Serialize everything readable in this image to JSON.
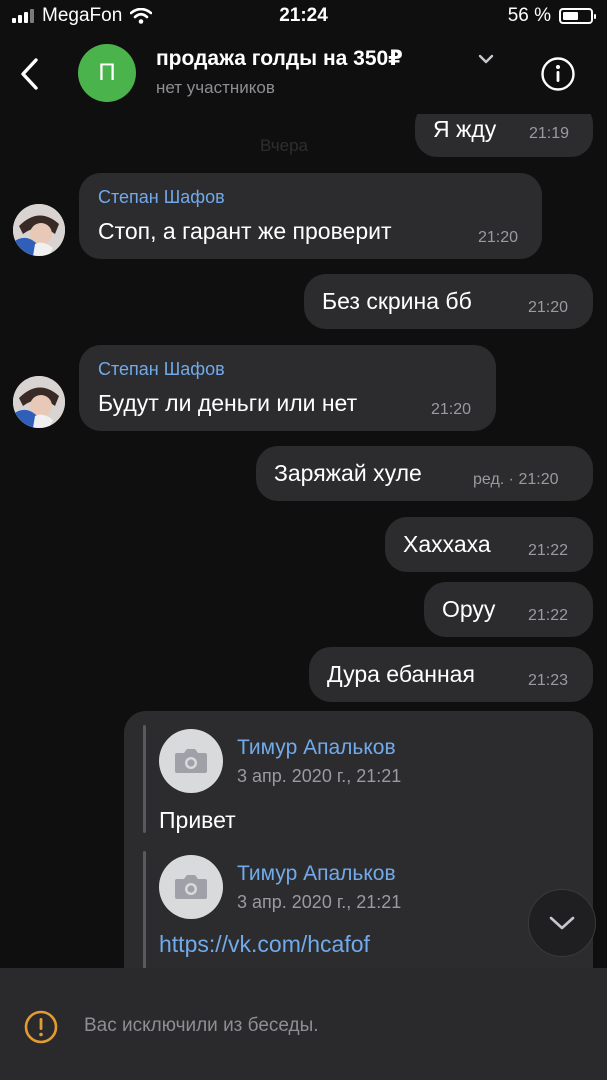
{
  "status_bar": {
    "carrier": "MegaFon",
    "time": "21:24",
    "battery": "56 %"
  },
  "header": {
    "avatar_letter": "П",
    "title": "продажа голды на 350₽",
    "subtitle": "нет участников"
  },
  "date_separator": "Вчера",
  "messages": [
    {
      "text": "Я жду",
      "time": "21:19"
    },
    {
      "author": "Степан Шафов",
      "text": "Стоп, а гарант же проверит",
      "time": "21:20"
    },
    {
      "text": "Без скрина бб",
      "time": "21:20"
    },
    {
      "author": "Степан Шафов",
      "text": "Будут ли деньги или нет",
      "time": "21:20"
    },
    {
      "text": "Заряжай хуле",
      "time": "ред. · 21:20"
    },
    {
      "text": "Хаххаха",
      "time": "21:22"
    },
    {
      "text": "Оруу",
      "time": "21:22"
    },
    {
      "text": "Дура ебанная",
      "time": "21:23"
    }
  ],
  "forwarded": [
    {
      "name": "Тимур Апальков",
      "date": "3 апр. 2020 г., 21:21",
      "text": "Привет"
    },
    {
      "name": "Тимур Апальков",
      "date": "3 апр. 2020 г., 21:21",
      "link": "https://vk.com/hcafof"
    }
  ],
  "footer": {
    "text": "Вас исключили из беседы."
  },
  "colors": {
    "bubble": "#2c2c2e",
    "accent": "#71aaeb",
    "avatar_green": "#4bb34b",
    "warning": "#e39b33"
  }
}
